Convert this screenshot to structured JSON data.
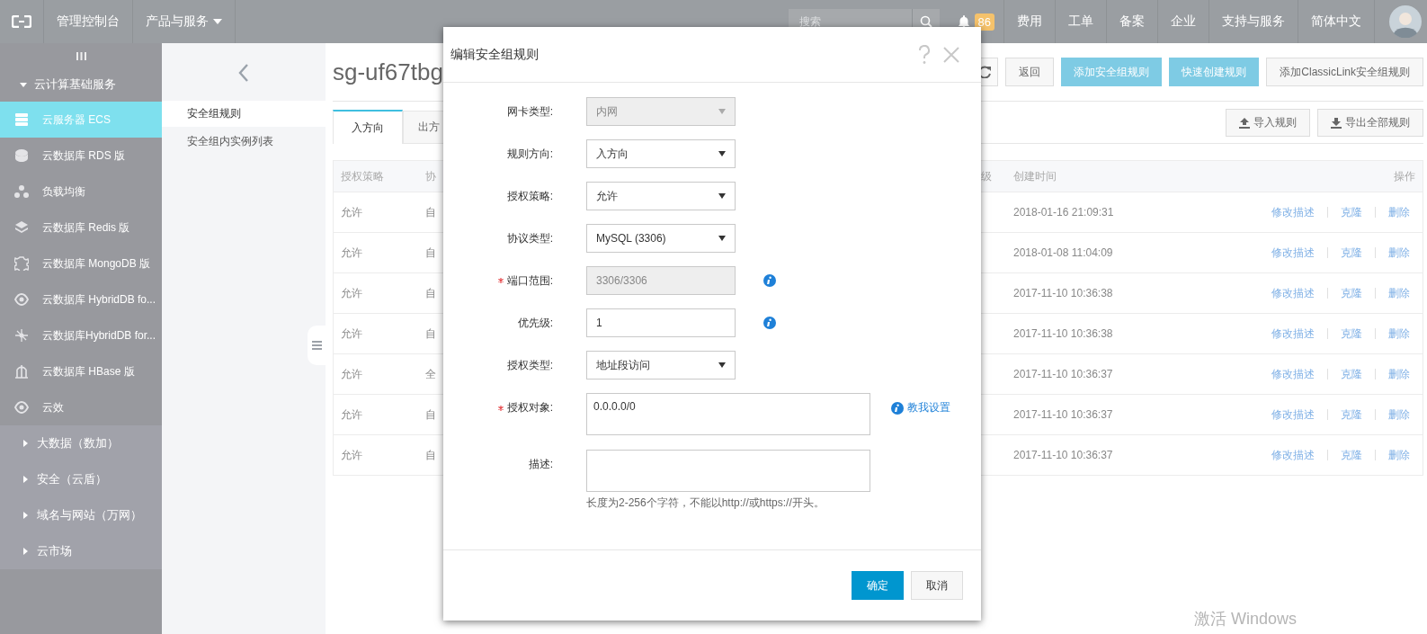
{
  "topbar": {
    "console": "管理控制台",
    "products": "产品与服务",
    "search": {
      "placeholder": "搜索"
    },
    "notifications": "86",
    "links": [
      "费用",
      "工单",
      "备案",
      "企业",
      "支持与服务",
      "简体中文"
    ]
  },
  "sidebar": {
    "group": {
      "label": "云计算基础服务",
      "expanded": true
    },
    "items": [
      {
        "label": "云服务器 ECS",
        "selected": true
      },
      {
        "label": "云数据库 RDS 版",
        "selected": false
      },
      {
        "label": "负载均衡",
        "selected": false
      },
      {
        "label": "云数据库 Redis 版",
        "selected": false
      },
      {
        "label": "云数据库 MongoDB 版",
        "selected": false
      },
      {
        "label": "云数据库 HybridDB fo...",
        "selected": false
      },
      {
        "label": "云数据库HybridDB for...",
        "selected": false
      },
      {
        "label": "云数据库 HBase 版",
        "selected": false
      },
      {
        "label": "云效",
        "selected": false
      }
    ],
    "groups": [
      {
        "label": "大数据（数加）",
        "expanded": false
      },
      {
        "label": "安全（云盾）",
        "expanded": false
      },
      {
        "label": "域名与网站（万网）",
        "expanded": false
      },
      {
        "label": "云市场",
        "expanded": false
      }
    ]
  },
  "subnav": {
    "items": [
      {
        "label": "安全组规则",
        "selected": true
      },
      {
        "label": "安全组内实例列表",
        "selected": false
      }
    ]
  },
  "page": {
    "title": "sg-uf67tbg",
    "buttons": [
      {
        "label": "返回",
        "kind": "plain"
      },
      {
        "label": "添加安全组规则",
        "kind": "primary"
      },
      {
        "label": "快速创建规则",
        "kind": "primary"
      },
      {
        "label": "添加ClassicLink安全组规则",
        "kind": "plain"
      }
    ],
    "tabs": [
      {
        "label": "入方向",
        "selected": true
      },
      {
        "label": "出方",
        "selected": false
      }
    ],
    "tools": [
      {
        "label": "导入规则",
        "kind": "upload"
      },
      {
        "label": "导出全部规则",
        "kind": "download"
      }
    ]
  },
  "table": {
    "columns": [
      "授权策略",
      "协",
      "级",
      "创建时间",
      "操作"
    ],
    "rows": [
      {
        "policy": "允许",
        "column_2": "自",
        "created": "2018-01-16 21:09:31",
        "actions": [
          "修改描述",
          "克隆",
          "删除"
        ]
      },
      {
        "policy": "允许",
        "column_2": "自",
        "created": "2018-01-08 11:04:09",
        "actions": [
          "修改描述",
          "克隆",
          "删除"
        ]
      },
      {
        "policy": "允许",
        "column_2": "自",
        "created": "2017-11-10 10:36:38",
        "actions": [
          "修改描述",
          "克隆",
          "删除"
        ]
      },
      {
        "policy": "允许",
        "column_2": "自",
        "created": "2017-11-10 10:36:38",
        "actions": [
          "修改描述",
          "克隆",
          "删除"
        ]
      },
      {
        "policy": "允许",
        "column_2": "全",
        "created": "2017-11-10 10:36:37",
        "actions": [
          "修改描述",
          "克隆",
          "删除"
        ]
      },
      {
        "policy": "允许",
        "column_2": "自",
        "created": "2017-11-10 10:36:37",
        "actions": [
          "修改描述",
          "克隆",
          "删除"
        ]
      },
      {
        "policy": "允许",
        "column_2": "自",
        "created": "2017-11-10 10:36:37",
        "actions": [
          "修改描述",
          "克隆",
          "删除"
        ]
      }
    ]
  },
  "dialog": {
    "title": "编辑安全组规则",
    "fields": [
      {
        "label": "网卡类型:",
        "kind": "select",
        "value": "内网",
        "disabled": true,
        "required": false,
        "info": false
      },
      {
        "label": "规则方向:",
        "kind": "select",
        "value": "入方向",
        "disabled": false,
        "required": false,
        "info": false
      },
      {
        "label": "授权策略:",
        "kind": "select",
        "value": "允许",
        "disabled": false,
        "required": false,
        "info": false
      },
      {
        "label": "协议类型:",
        "kind": "select",
        "value": "MySQL (3306)",
        "disabled": false,
        "required": false,
        "info": false
      },
      {
        "label": "端口范围:",
        "kind": "input",
        "value": "3306/3306",
        "disabled": true,
        "required": true,
        "info": true
      },
      {
        "label": "优先级:",
        "kind": "input",
        "value": "1",
        "disabled": false,
        "required": false,
        "info": true
      },
      {
        "label": "授权类型:",
        "kind": "select",
        "value": "地址段访问",
        "disabled": false,
        "required": false,
        "info": false
      },
      {
        "label": "授权对象:",
        "kind": "textarea",
        "value": "0.0.0.0/0",
        "disabled": false,
        "required": true,
        "info": false,
        "help_link": "教我设置"
      },
      {
        "label": "描述:",
        "kind": "textarea",
        "disabled": false,
        "required": false,
        "info": false,
        "hint": "长度为2-256个字符，不能以http://或https://开头。"
      }
    ],
    "buttons": [
      {
        "label": "确定",
        "kind": "primary"
      },
      {
        "label": "取消",
        "kind": "plain"
      }
    ]
  },
  "watermark": "激活 Windows"
}
